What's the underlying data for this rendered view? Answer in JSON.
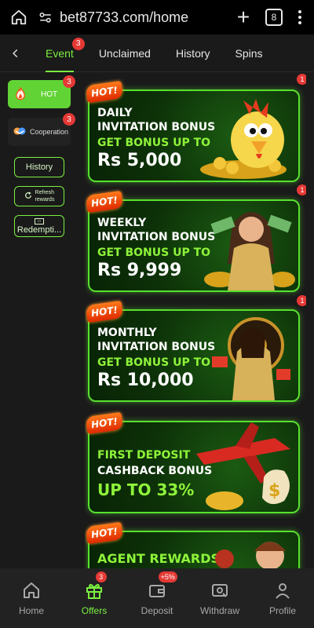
{
  "browser": {
    "url": "bet87733.com/home",
    "tab_count": "8"
  },
  "tabs": [
    {
      "label": "Event",
      "badge": "3"
    },
    {
      "label": "Unclaimed"
    },
    {
      "label": "History"
    },
    {
      "label": "Spins"
    }
  ],
  "sidebar": {
    "hot": {
      "label": "HOT",
      "badge": "3"
    },
    "cooperation": {
      "label": "Cooperation",
      "badge": "3"
    },
    "history_label": "History",
    "refresh_line1": "Refresh",
    "refresh_line2": "rewards",
    "redemption_label": "Redempti..."
  },
  "banners": [
    {
      "hot": "HOT!",
      "badge": "1",
      "line1": "DAILY",
      "line2": "INVITATION BONUS",
      "line3": "GET BONUS UP TO",
      "line4": "Rs 5,000"
    },
    {
      "hot": "HOT!",
      "badge": "1",
      "line1": "WEEKLY",
      "line2": "INVITATION BONUS",
      "line3": "GET BONUS UP TO",
      "line4": "Rs 9,999"
    },
    {
      "hot": "HOT!",
      "badge": "1",
      "line1": "MONTHLY",
      "line2": "INVITATION BONUS",
      "line3": "GET BONUS UP TO",
      "line4": "Rs 10,000"
    },
    {
      "hot": "HOT!",
      "line1": "FIRST DEPOSIT",
      "line2": "CASHBACK BONUS",
      "line3": "UP TO 33%"
    },
    {
      "hot": "HOT!",
      "line1": "AGENT REWARDS"
    }
  ],
  "bottom_nav": [
    {
      "label": "Home",
      "icon": "home-icon"
    },
    {
      "label": "Offers",
      "icon": "gift-icon",
      "badge": "3"
    },
    {
      "label": "Deposit",
      "icon": "wallet-icon",
      "badge": "+5%"
    },
    {
      "label": "Withdraw",
      "icon": "withdraw-icon"
    },
    {
      "label": "Profile",
      "icon": "profile-icon"
    }
  ],
  "colors": {
    "accent": "#7bf040",
    "badge": "#e53935",
    "hot_tag": "#ff5a10",
    "background": "#1a1a1a"
  }
}
